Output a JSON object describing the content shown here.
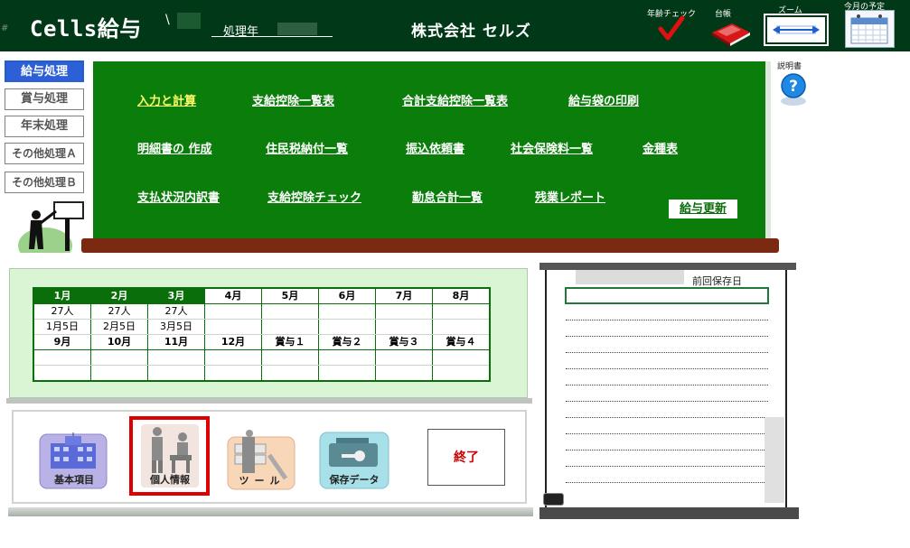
{
  "header": {
    "app_title": "Cells給与",
    "hash_mark": "#",
    "user_tick": "\\",
    "year_label": "処理年",
    "company": "株式会社  セルズ",
    "age_check_label": "年齢チェック",
    "ledger_label": "台帳",
    "zoom_label": "ズーム",
    "schedule_label": "今月の予定"
  },
  "side_menu": {
    "items": [
      {
        "label": "給与処理",
        "active": true
      },
      {
        "label": "賞与処理"
      },
      {
        "label": "年末処理"
      },
      {
        "label": "その他処理Ａ"
      },
      {
        "label": "その他処理Ｂ"
      }
    ]
  },
  "board": {
    "links": [
      "入力と計算",
      "支給控除一覧表",
      "合計支給控除一覧表",
      "給与袋の印刷",
      "明細書の 作成",
      "住民税納付一覧",
      "振込依頼書",
      "社会保険料一覧",
      "金種表",
      "支払状況内訳書",
      "支給控除チェック",
      "勤怠合計一覧",
      "残業レポート"
    ],
    "update_button": "給与更新",
    "help_label": "説明書"
  },
  "months": {
    "row1": [
      "1月",
      "2月",
      "3月",
      "4月",
      "5月",
      "6月",
      "7月",
      "8月"
    ],
    "row1_counts": [
      "27人",
      "27人",
      "27人",
      "",
      "",
      "",
      "",
      ""
    ],
    "row1_dates": [
      "1月5日",
      "2月5日",
      "3月5日",
      "",
      "",
      "",
      "",
      ""
    ],
    "row2": [
      "9月",
      "10月",
      "11月",
      "12月",
      "賞与１",
      "賞与２",
      "賞与３",
      "賞与４"
    ]
  },
  "buttons": {
    "basic": "基本項目",
    "personal": "個人情報",
    "tools": "ツール",
    "saved": "保存データ",
    "end": "終了"
  },
  "memo": {
    "last_save_label": "前回保存日"
  },
  "colors": {
    "header_bg": "#003818",
    "board_green": "#0b7d0b",
    "active_blue": "#2d5fd6",
    "highlight_red": "#dd0000"
  }
}
